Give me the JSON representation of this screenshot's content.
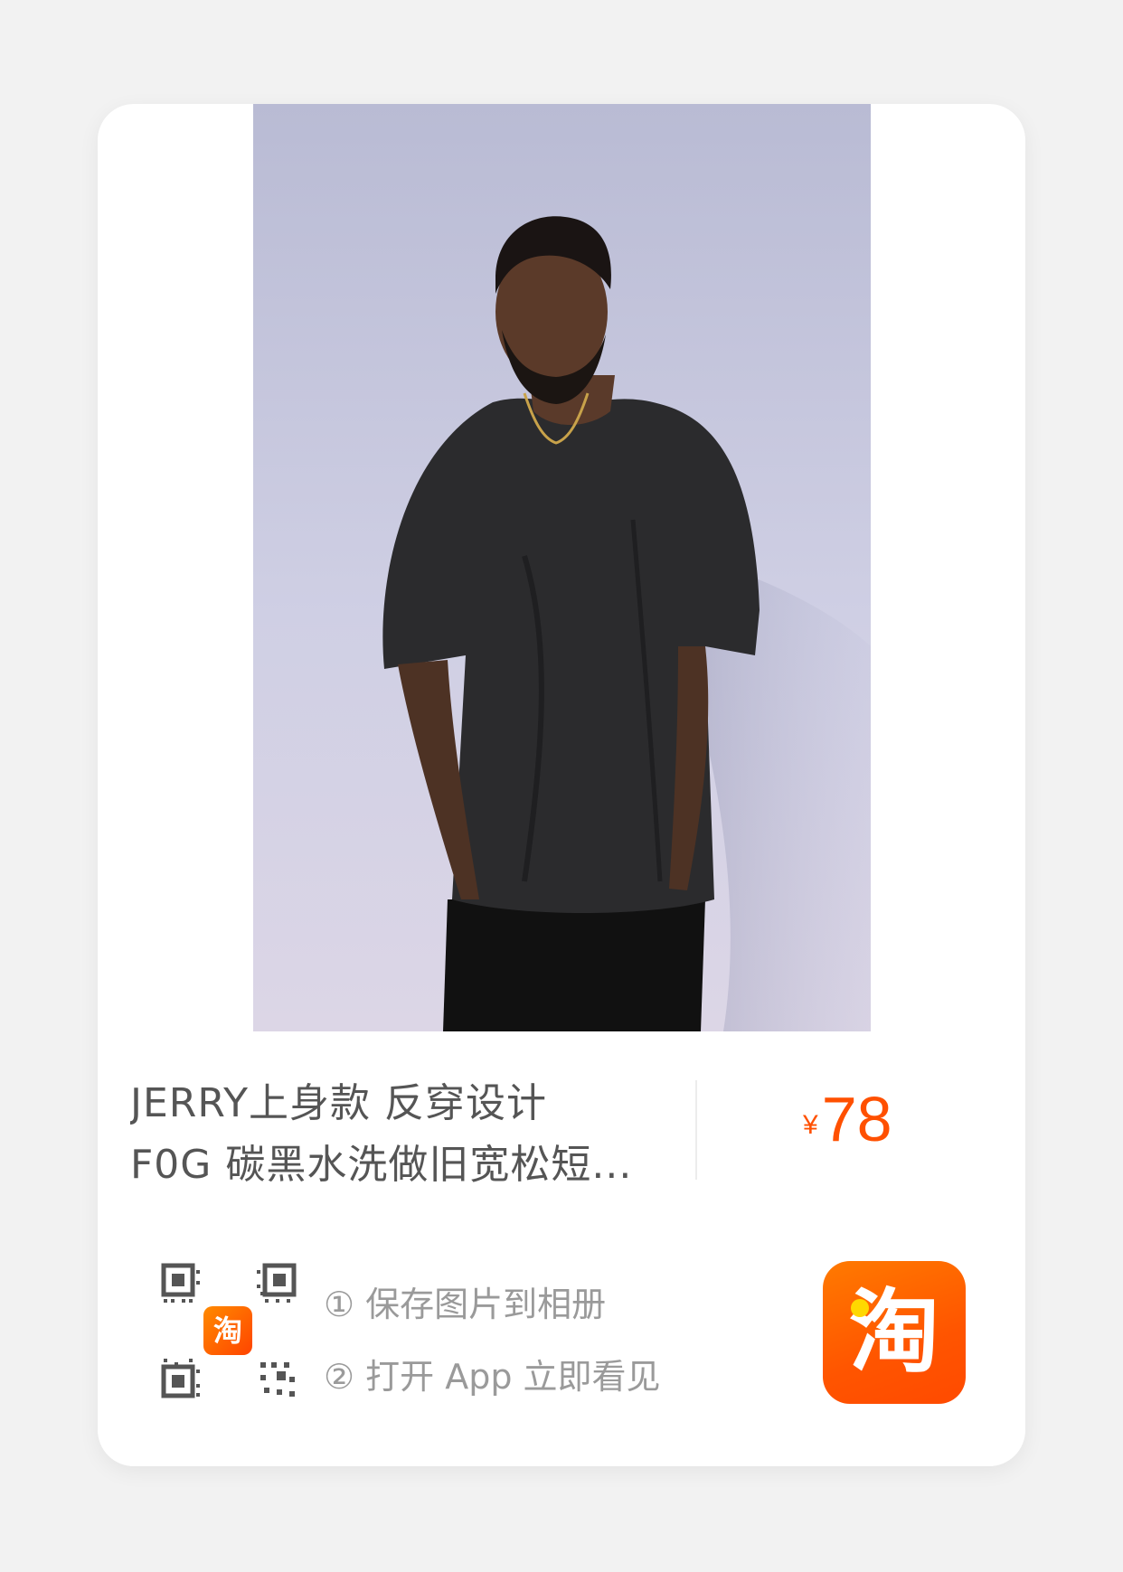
{
  "product": {
    "title_line1": "JERRY上身款 反穿设计",
    "title_line2": "F0G 碳黑水洗做旧宽松短...",
    "currency": "¥",
    "price": "78"
  },
  "share": {
    "qr_badge": "淘",
    "step1": "① 保存图片到相册",
    "step2": "② 打开 App 立即看见"
  },
  "app": {
    "logo_glyph": "淘"
  },
  "colors": {
    "accent": "#ff5000",
    "background": "#f2f2f2",
    "card": "#ffffff"
  }
}
